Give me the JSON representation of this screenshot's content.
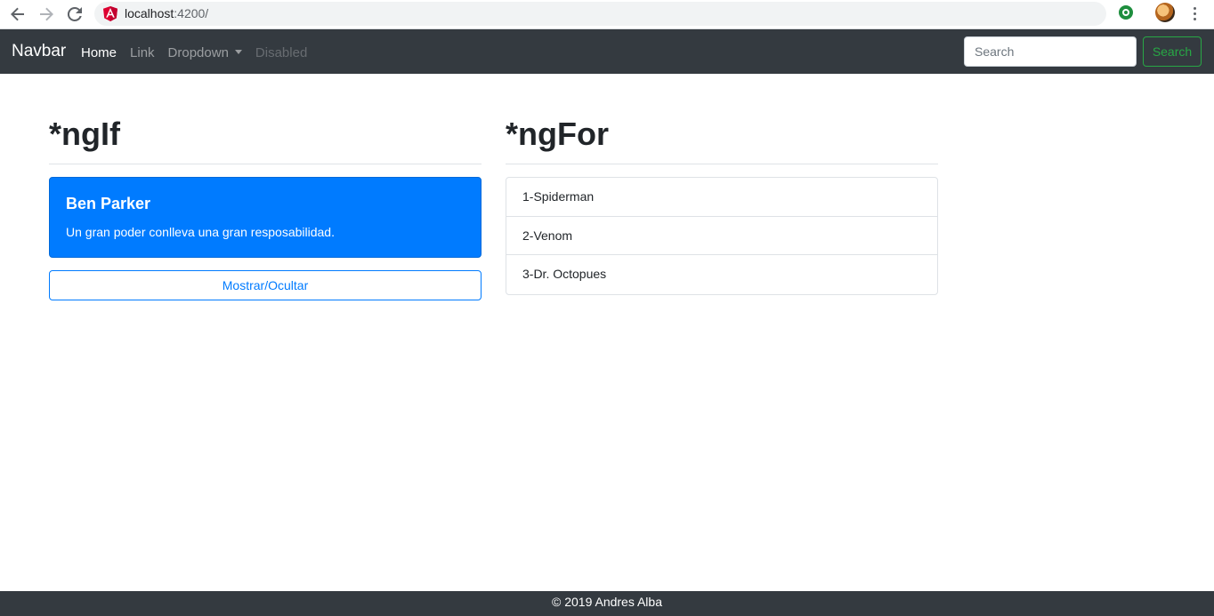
{
  "browser": {
    "url_host": "localhost",
    "url_port": ":4200/",
    "icons": [
      "back-arrow-icon",
      "forward-arrow-icon",
      "reload-icon",
      "angular-site-icon",
      "extension-icon",
      "profile-avatar",
      "menu-dots-icon"
    ]
  },
  "navbar": {
    "brand": "Navbar",
    "links": [
      {
        "label": "Home",
        "state": "active"
      },
      {
        "label": "Link",
        "state": "normal"
      },
      {
        "label": "Dropdown",
        "state": "normal"
      },
      {
        "label": "Disabled",
        "state": "disabled"
      }
    ],
    "search_placeholder": "Search",
    "search_button": "Search"
  },
  "ngif": {
    "heading": "*ngIf",
    "alert_title": "Ben Parker",
    "alert_text": "Un gran poder conlleva una gran resposabilidad.",
    "toggle_button": "Mostrar/Ocultar"
  },
  "ngfor": {
    "heading": "*ngFor",
    "items": [
      "1-Spiderman",
      "2-Venom",
      "3-Dr. Octopues"
    ]
  },
  "footer": {
    "text": "© 2019 Andres Alba"
  },
  "colors": {
    "navbar_bg": "#343a40",
    "primary": "#007bff",
    "success": "#28a745"
  }
}
